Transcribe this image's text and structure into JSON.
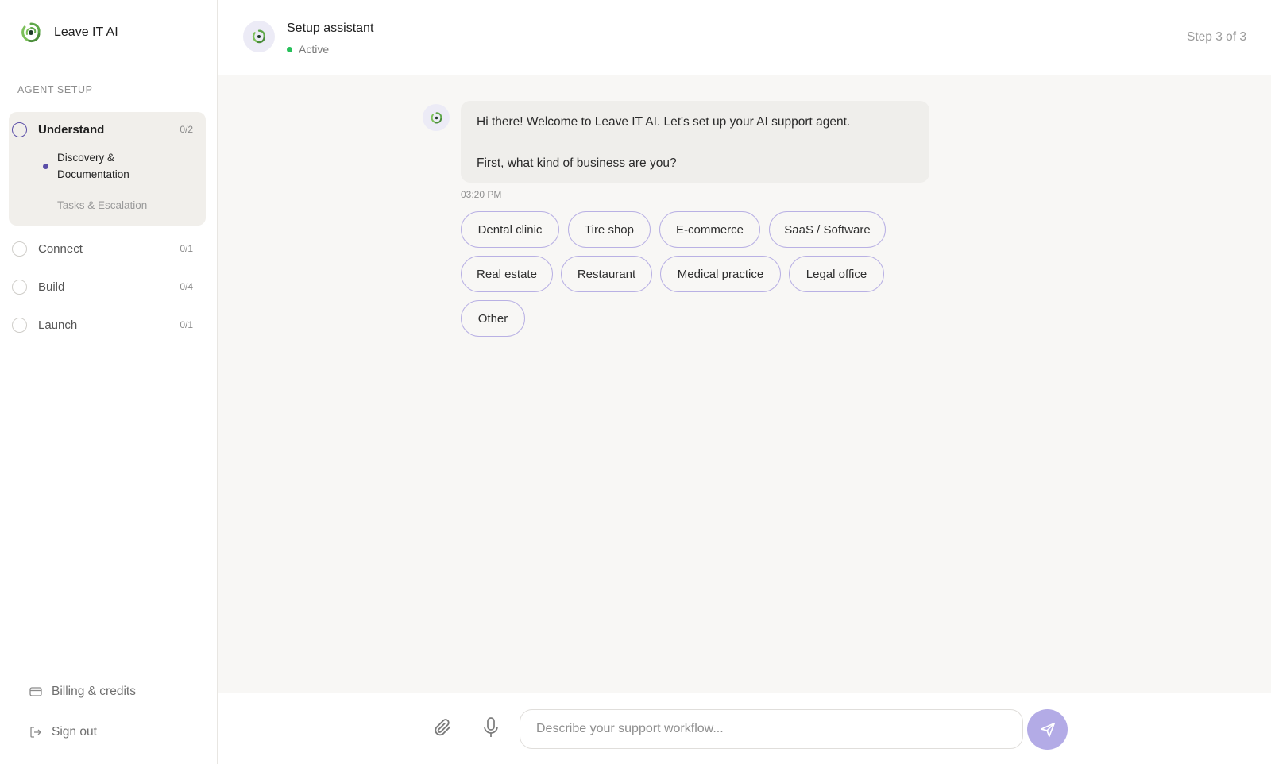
{
  "app": {
    "name": "Leave IT AI"
  },
  "sidebar": {
    "section_label": "AGENT SETUP",
    "steps": [
      {
        "name": "Understand",
        "count": "0/2",
        "active": true,
        "substeps": [
          {
            "label": "Discovery & Documentation",
            "state": "current"
          },
          {
            "label": "Tasks & Escalation",
            "state": "pending"
          }
        ]
      },
      {
        "name": "Connect",
        "count": "0/1",
        "active": false
      },
      {
        "name": "Build",
        "count": "0/4",
        "active": false
      },
      {
        "name": "Launch",
        "count": "0/1",
        "active": false
      }
    ],
    "billing_label": "Billing & credits",
    "signout_label": "Sign out"
  },
  "header": {
    "title": "Setup assistant",
    "status": "Active",
    "step_indicator": "Step 3 of 3"
  },
  "chat": {
    "message": {
      "line1": "Hi there! Welcome to Leave IT AI. Let's set up your AI support agent.",
      "line2": "First, what kind of business are you?",
      "time": "03:20 PM"
    },
    "options": [
      "Dental clinic",
      "Tire shop",
      "E-commerce",
      "SaaS / Software",
      "Real estate",
      "Restaurant",
      "Medical practice",
      "Legal office",
      "Other"
    ]
  },
  "composer": {
    "placeholder": "Describe your support workflow...",
    "value": ""
  },
  "colors": {
    "accent": "#5b4ea8",
    "chip_border": "#b9b1e4",
    "send_button": "#b3abe6",
    "status_active": "#27c05a",
    "logo_green": "#5fa84a"
  },
  "icons": [
    "swirl-logo-icon",
    "circle-icon",
    "credit-card-icon",
    "sign-out-icon",
    "paperclip-icon",
    "microphone-icon",
    "send-icon"
  ]
}
